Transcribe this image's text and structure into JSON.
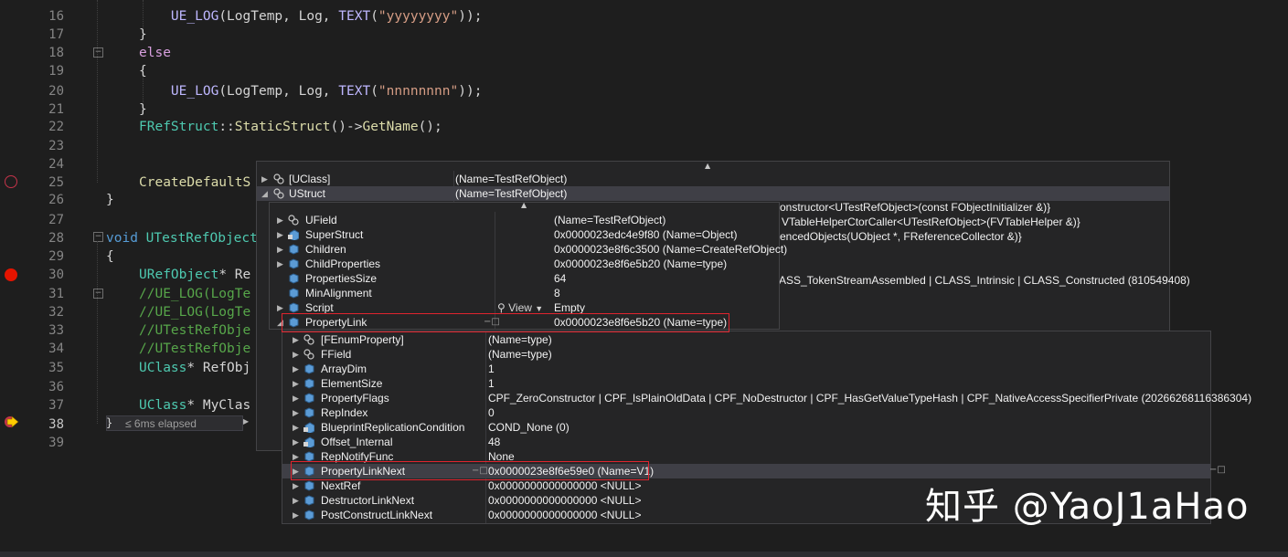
{
  "editor": {
    "line_numbers": [
      "16",
      "17",
      "18",
      "19",
      "20",
      "21",
      "22",
      "23",
      "24",
      "25",
      "26",
      "27",
      "28",
      "29",
      "30",
      "31",
      "32",
      "33",
      "34",
      "35",
      "36",
      "37",
      "38",
      "39"
    ],
    "current_line": "38",
    "elapsed_label": "≤ 6ms elapsed",
    "lines": {
      "l16_macro": "UE_LOG",
      "l16_args": "(LogTemp, Log, ",
      "l16_text": "TEXT",
      "l16_str": "\"yyyyyyyy\"",
      "l16_end": "));",
      "l17": "}",
      "l18": "else",
      "l19": "{",
      "l20_macro": "UE_LOG",
      "l20_args": "(LogTemp, Log, ",
      "l20_text": "TEXT",
      "l20_str": "\"nnnnnnnn\"",
      "l20_end": "));",
      "l21": "}",
      "l22_type": "FRefStruct",
      "l22_sep": "::",
      "l22_fn": "StaticStruct",
      "l22_mid": "()->",
      "l22_fn2": "GetName",
      "l22_end": "();",
      "l25_fn": "CreateDefaultS",
      "l26": "}",
      "l28_kw": "void",
      "l28_type": "UTestRefObject",
      "l29": "{",
      "l30_type": "URefObject",
      "l30_rest": "* Re",
      "l31": "//UE_LOG(LogTe",
      "l32": "//UE_LOG(LogTe",
      "l33": "//UTestRefObje",
      "l34": "//UTestRefObje",
      "l35_type": "UClass",
      "l35_rest": "* RefObj",
      "l37_type": "UClass",
      "l37_rest": "* MyClas"
    }
  },
  "outer_popup": {
    "rows": [
      {
        "name": "[UClass]",
        "value": "(Name=TestRefObject)"
      },
      {
        "name": "UStruct",
        "value": "(Name=TestRefObject)"
      }
    ],
    "overflow_values": [
      "onstructor<UTestRefObject>(const FObjectInitializer &)}",
      "VTableHelperCtorCaller<UTestRefObject>(FVTableHelper &)}",
      "encedObjects(UObject *, FReferenceCollector &)}",
      "ASS_TokenStreamAssembled | CLASS_Intrinsic | CLASS_Constructed (810549408)"
    ]
  },
  "mid_popup": {
    "rows": [
      {
        "name": "UField",
        "value": "(Name=TestRefObject)"
      },
      {
        "name": "SuperStruct",
        "value": "0x0000023edc4e9f80 (Name=Object)"
      },
      {
        "name": "Children",
        "value": "0x0000023e8f6c3500 (Name=CreateRefObject)"
      },
      {
        "name": "ChildProperties",
        "value": "0x0000023e8f6e5b20 (Name=type)"
      },
      {
        "name": "PropertiesSize",
        "value": "64"
      },
      {
        "name": "MinAlignment",
        "value": "8"
      },
      {
        "name": "Script",
        "value": "Empty",
        "view_label": "View"
      },
      {
        "name": "PropertyLink",
        "value": "0x0000023e8f6e5b20 (Name=type)"
      }
    ]
  },
  "inner_popup": {
    "rows": [
      {
        "name": "[FEnumProperty]",
        "value": "(Name=type)"
      },
      {
        "name": "FField",
        "value": "(Name=type)"
      },
      {
        "name": "ArrayDim",
        "value": "1"
      },
      {
        "name": "ElementSize",
        "value": "1"
      },
      {
        "name": "PropertyFlags",
        "value": "CPF_ZeroConstructor | CPF_IsPlainOldData | CPF_NoDestructor | CPF_HasGetValueTypeHash | CPF_NativeAccessSpecifierPrivate (20266268116386304)"
      },
      {
        "name": "RepIndex",
        "value": "0"
      },
      {
        "name": "BlueprintReplicationCondition",
        "value": "COND_None (0)"
      },
      {
        "name": "Offset_Internal",
        "value": "48"
      },
      {
        "name": "RepNotifyFunc",
        "value": "None"
      },
      {
        "name": "PropertyLinkNext",
        "value": "0x0000023e8f6e59e0 (Name=V1)"
      },
      {
        "name": "NextRef",
        "value": "0x0000000000000000 <NULL>"
      },
      {
        "name": "DestructorLinkNext",
        "value": "0x0000000000000000 <NULL>"
      },
      {
        "name": "PostConstructLinkNext",
        "value": "0x0000000000000000 <NULL>"
      }
    ]
  },
  "watermark": "知乎 @YaoJ1aHao",
  "colors": {
    "highlight_box": "#e0242e",
    "breakpoint": "#e51400",
    "background": "#1e1e1e"
  }
}
